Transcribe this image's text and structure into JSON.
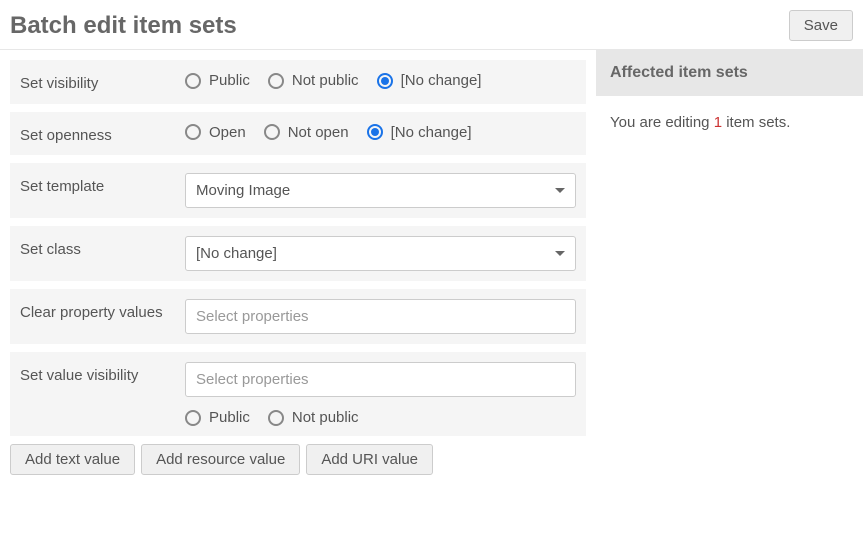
{
  "header": {
    "title": "Batch edit item sets",
    "save_label": "Save"
  },
  "fields": {
    "visibility": {
      "label": "Set visibility",
      "options": {
        "public": "Public",
        "not_public": "Not public",
        "no_change": "[No change]"
      }
    },
    "openness": {
      "label": "Set openness",
      "options": {
        "open": "Open",
        "not_open": "Not open",
        "no_change": "[No change]"
      }
    },
    "template": {
      "label": "Set template",
      "value": "Moving Image"
    },
    "class": {
      "label": "Set class",
      "value": "[No change]"
    },
    "clear_property": {
      "label": "Clear property values",
      "placeholder": "Select properties"
    },
    "value_visibility": {
      "label": "Set value visibility",
      "placeholder": "Select properties",
      "options": {
        "public": "Public",
        "not_public": "Not public"
      }
    }
  },
  "actions": {
    "add_text": "Add text value",
    "add_resource": "Add resource value",
    "add_uri": "Add URI value"
  },
  "sidebar": {
    "header": "Affected item sets",
    "prefix": "You are editing ",
    "count": "1",
    "suffix": " item sets."
  }
}
